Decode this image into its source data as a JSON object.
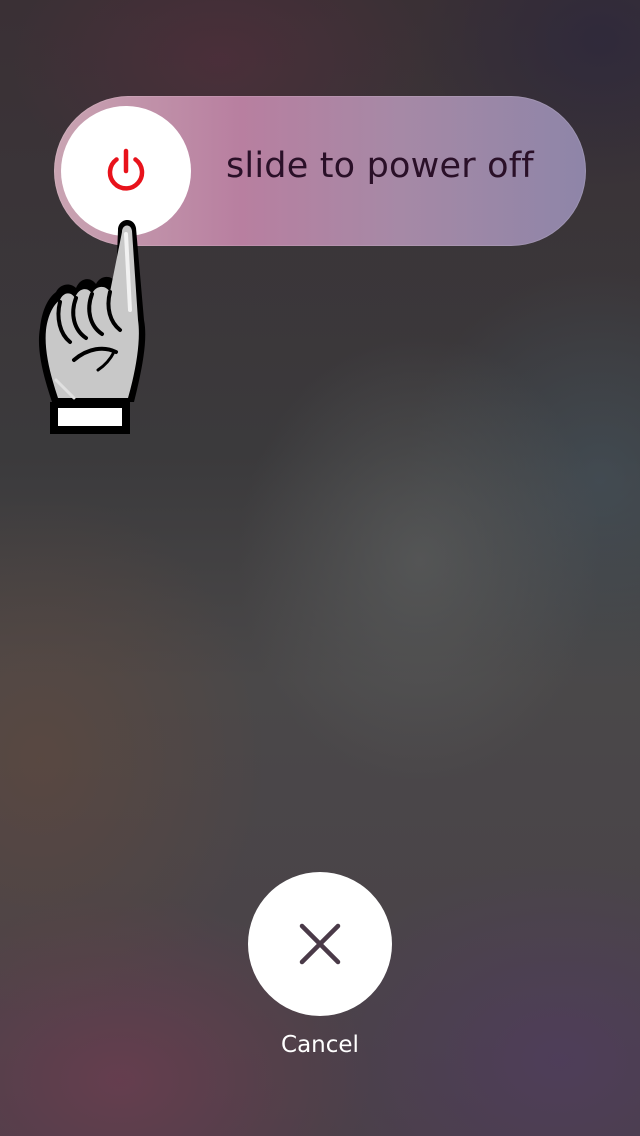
{
  "power_slider": {
    "label": "slide to power off",
    "knob_icon": "power-icon",
    "icon_color": "#e8121b"
  },
  "hint": {
    "icon": "pointing-hand-icon"
  },
  "cancel": {
    "label": "Cancel",
    "icon": "close-icon",
    "icon_color": "#4a3a48"
  }
}
